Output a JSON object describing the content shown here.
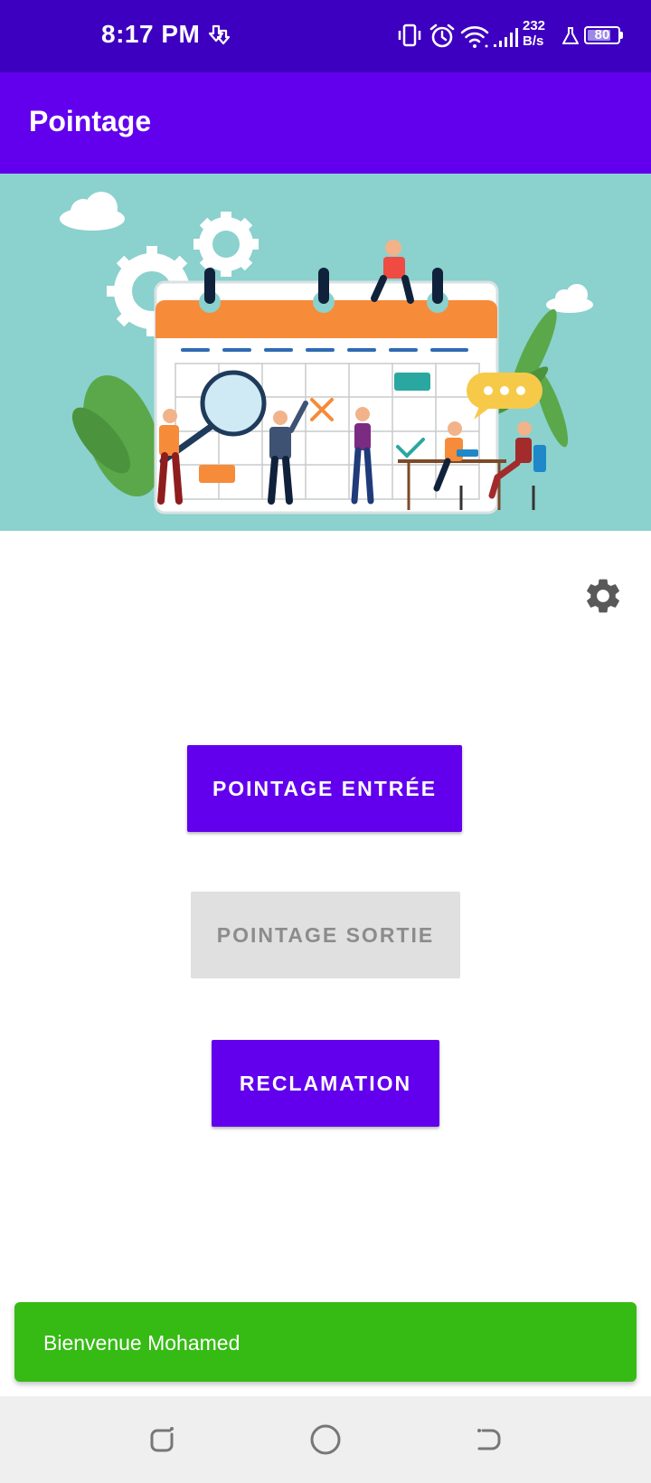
{
  "status_bar": {
    "time": "8:17 PM",
    "net_speed_value": "232",
    "net_speed_unit": "B/s",
    "battery_level": "80",
    "icons": [
      "download-notification-icon",
      "vibrate-icon",
      "alarm-icon",
      "wifi-icon",
      "signal-icon",
      "flask-icon",
      "battery-icon"
    ]
  },
  "app_bar": {
    "title": "Pointage"
  },
  "hero": {
    "icon": "calendar-team-illustration"
  },
  "settings": {
    "icon": "gear-icon"
  },
  "buttons": {
    "entry": "POINTAGE ENTRÉE",
    "exit": "POINTAGE SORTIE",
    "claim": "RECLAMATION"
  },
  "snackbar": {
    "message": "Bienvenue Mohamed"
  },
  "nav_bar": {
    "icons": [
      "recent-apps-icon",
      "home-icon",
      "back-icon"
    ]
  },
  "colors": {
    "status_bar": "#3e00c0",
    "primary": "#6200ee",
    "hero_background": "#8bd1ce",
    "snackbar": "#35bb14",
    "disabled_button": "#e0e0e0"
  }
}
